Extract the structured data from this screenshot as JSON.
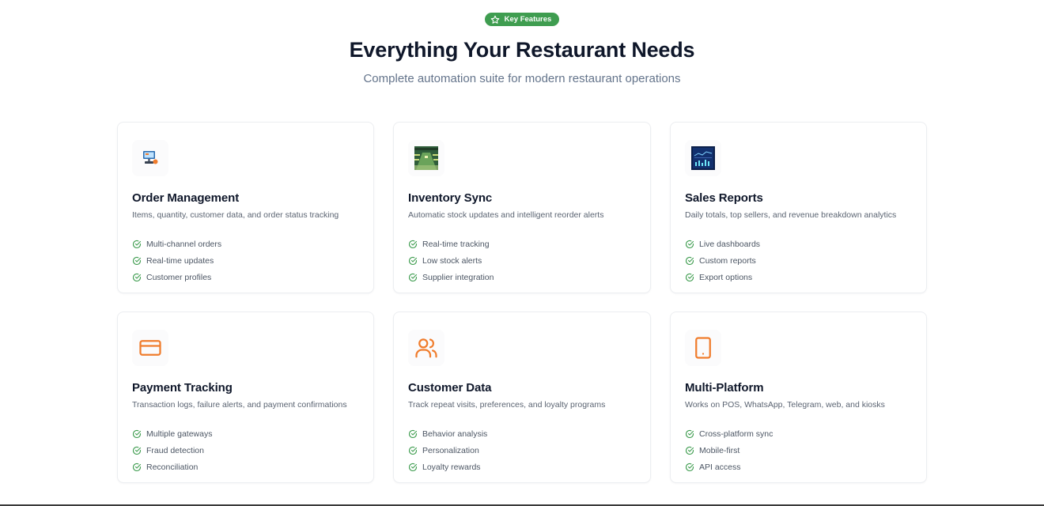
{
  "header": {
    "badge": {
      "label": "Key Features",
      "icon": "star-icon",
      "color": "#3f9d50"
    },
    "title": "Everything Your Restaurant Needs",
    "subtitle": "Complete automation suite for modern restaurant operations"
  },
  "colors": {
    "accent": "#f07c2c",
    "check": "#3f9d50",
    "title": "#0f172a",
    "muted": "#64748b"
  },
  "features": [
    {
      "icon": "pos-terminal-icon",
      "title": "Order Management",
      "description": "Items, quantity, customer data, and order status tracking",
      "items": [
        "Multi-channel orders",
        "Real-time updates",
        "Customer profiles"
      ]
    },
    {
      "icon": "warehouse-aisle-icon",
      "title": "Inventory Sync",
      "description": "Automatic stock updates and intelligent reorder alerts",
      "items": [
        "Real-time tracking",
        "Low stock alerts",
        "Supplier integration"
      ]
    },
    {
      "icon": "analytics-dashboard-icon",
      "title": "Sales Reports",
      "description": "Daily totals, top sellers, and revenue breakdown analytics",
      "items": [
        "Live dashboards",
        "Custom reports",
        "Export options"
      ]
    },
    {
      "icon": "credit-card-icon",
      "title": "Payment Tracking",
      "description": "Transaction logs, failure alerts, and payment confirmations",
      "items": [
        "Multiple gateways",
        "Fraud detection",
        "Reconciliation"
      ]
    },
    {
      "icon": "users-icon",
      "title": "Customer Data",
      "description": "Track repeat visits, preferences, and loyalty programs",
      "items": [
        "Behavior analysis",
        "Personalization",
        "Loyalty rewards"
      ]
    },
    {
      "icon": "tablet-icon",
      "title": "Multi-Platform",
      "description": "Works on POS, WhatsApp, Telegram, web, and kiosks",
      "items": [
        "Cross-platform sync",
        "Mobile-first",
        "API access"
      ]
    }
  ]
}
